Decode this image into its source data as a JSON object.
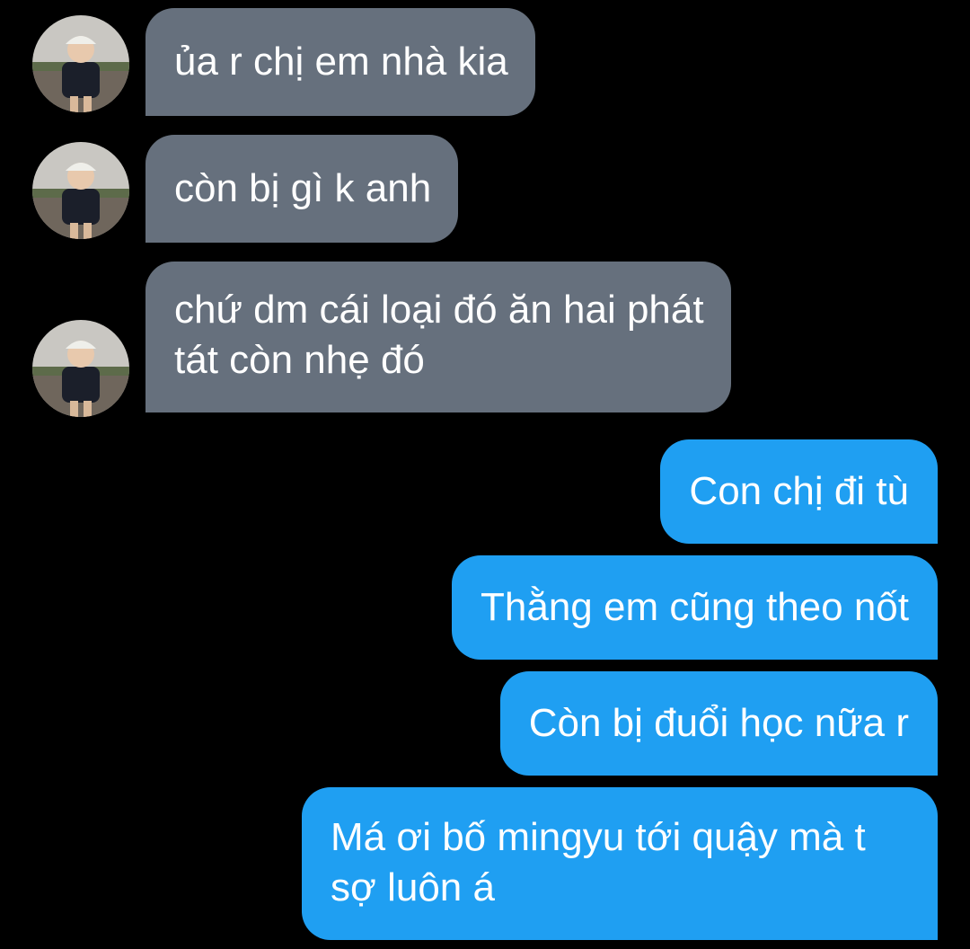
{
  "conversation": {
    "incoming": [
      {
        "text": "ủa r chị em nhà kia"
      },
      {
        "text": "còn bị gì k anh"
      },
      {
        "lines": [
          "chứ dm cái loại đó ăn hai phát",
          "tát còn nhẹ đó"
        ]
      }
    ],
    "outgoing": [
      {
        "text": "Con chị đi tù"
      },
      {
        "text": "Thằng em cũng theo nốt"
      },
      {
        "text": "Còn bị đuổi học nữa r"
      },
      {
        "lines": [
          "Má ơi bố mingyu tới quậy mà t",
          "sợ luôn á"
        ]
      }
    ]
  },
  "colors": {
    "background": "#000000",
    "incoming_bubble": "#66707d",
    "outgoing_bubble": "#1f9ff2",
    "text": "#ffffff"
  },
  "icons": {
    "avatar": "contact-avatar-photo"
  }
}
